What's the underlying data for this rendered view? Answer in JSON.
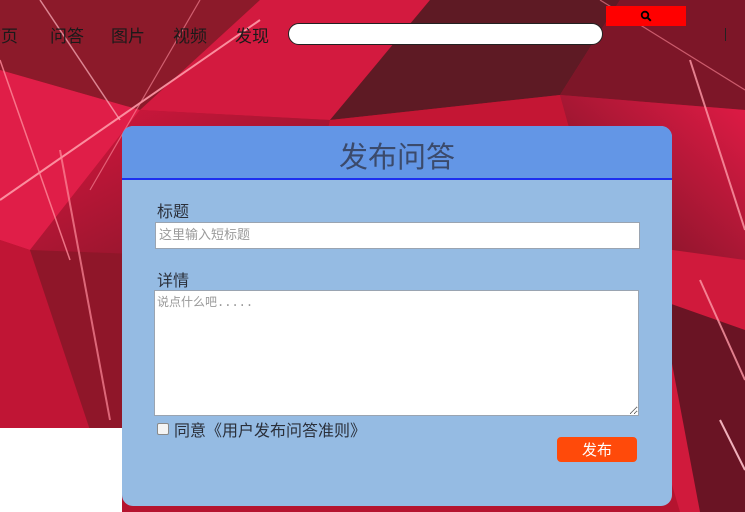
{
  "nav": {
    "items": [
      {
        "label": "首页"
      },
      {
        "label": "问答"
      },
      {
        "label": "图片"
      },
      {
        "label": "视频"
      },
      {
        "label": "发现"
      }
    ],
    "search": {
      "placeholder": "",
      "value": ""
    },
    "search_icon": "search-icon"
  },
  "form": {
    "title": "发布问答",
    "title_label": "标题",
    "title_placeholder": "这里输入短标题",
    "detail_label": "详情",
    "detail_placeholder": "说点什么吧.....",
    "agree_label": "同意《用户发布问答准则》",
    "agree_checked": false,
    "publish_label": "发布"
  },
  "colors": {
    "background": "#b3132d",
    "card": "#95bbe3",
    "card_header": "#6396e6",
    "header_border": "#1d2ff0",
    "search_button": "#ff0000",
    "publish_button": "#ff4a0a"
  }
}
